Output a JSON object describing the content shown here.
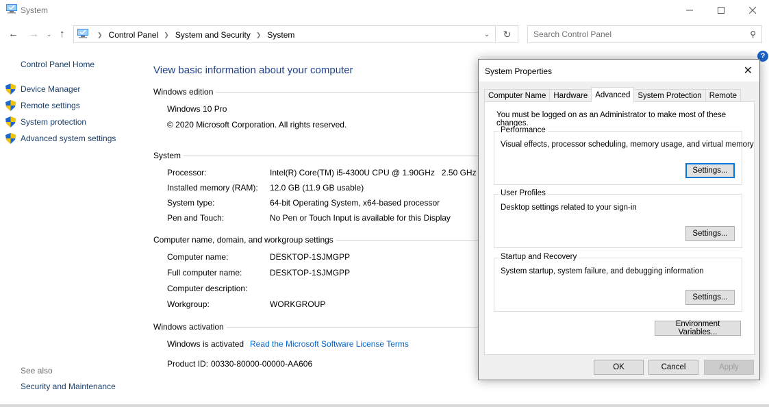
{
  "window": {
    "title": "System",
    "controls": {
      "minimize": "minimize",
      "maximize": "maximize",
      "close": "close"
    }
  },
  "nav": {
    "breadcrumbs": [
      "Control Panel",
      "System and Security",
      "System"
    ],
    "search_placeholder": "Search Control Panel"
  },
  "sidebar": {
    "home": "Control Panel Home",
    "items": [
      {
        "label": "Device Manager",
        "icon": "shield-icon"
      },
      {
        "label": "Remote settings",
        "icon": "shield-icon"
      },
      {
        "label": "System protection",
        "icon": "shield-icon"
      },
      {
        "label": "Advanced system settings",
        "icon": "shield-icon"
      }
    ],
    "see_also": "See also",
    "see_also_links": [
      "Security and Maintenance"
    ]
  },
  "main": {
    "title": "View basic information about your computer",
    "edition": {
      "heading": "Windows edition",
      "name": "Windows 10 Pro",
      "copyright": "© 2020 Microsoft Corporation. All rights reserved."
    },
    "system": {
      "heading": "System",
      "rows": [
        {
          "label": "Processor:",
          "value": "Intel(R) Core(TM) i5-4300U CPU @ 1.90GHz   2.50 GHz"
        },
        {
          "label": "Installed memory (RAM):",
          "value": "12.0 GB (11.9 GB usable)"
        },
        {
          "label": "System type:",
          "value": "64-bit Operating System, x64-based processor"
        },
        {
          "label": "Pen and Touch:",
          "value": "No Pen or Touch Input is available for this Display"
        }
      ]
    },
    "computer_name": {
      "heading": "Computer name, domain, and workgroup settings",
      "rows": [
        {
          "label": "Computer name:",
          "value": "DESKTOP-1SJMGPP"
        },
        {
          "label": "Full computer name:",
          "value": "DESKTOP-1SJMGPP"
        },
        {
          "label": "Computer description:",
          "value": ""
        },
        {
          "label": "Workgroup:",
          "value": "WORKGROUP"
        }
      ]
    },
    "activation": {
      "heading": "Windows activation",
      "status": "Windows is activated",
      "license_link": "Read the Microsoft Software License Terms",
      "product_id_label": "Product ID:",
      "product_id": "00330-80000-00000-AA606"
    }
  },
  "dialog": {
    "title": "System Properties",
    "tabs": [
      "Computer Name",
      "Hardware",
      "Advanced",
      "System Protection",
      "Remote"
    ],
    "active_tab": "Advanced",
    "admin_note": "You must be logged on as an Administrator to make most of these changes.",
    "groups": [
      {
        "legend": "Performance",
        "description": "Visual effects, processor scheduling, memory usage, and virtual memory",
        "button": "Settings..."
      },
      {
        "legend": "User Profiles",
        "description": "Desktop settings related to your sign-in",
        "button": "Settings..."
      },
      {
        "legend": "Startup and Recovery",
        "description": "System startup, system failure, and debugging information",
        "button": "Settings..."
      }
    ],
    "env_button": "Environment Variables...",
    "ok": "OK",
    "cancel": "Cancel",
    "apply": "Apply"
  }
}
